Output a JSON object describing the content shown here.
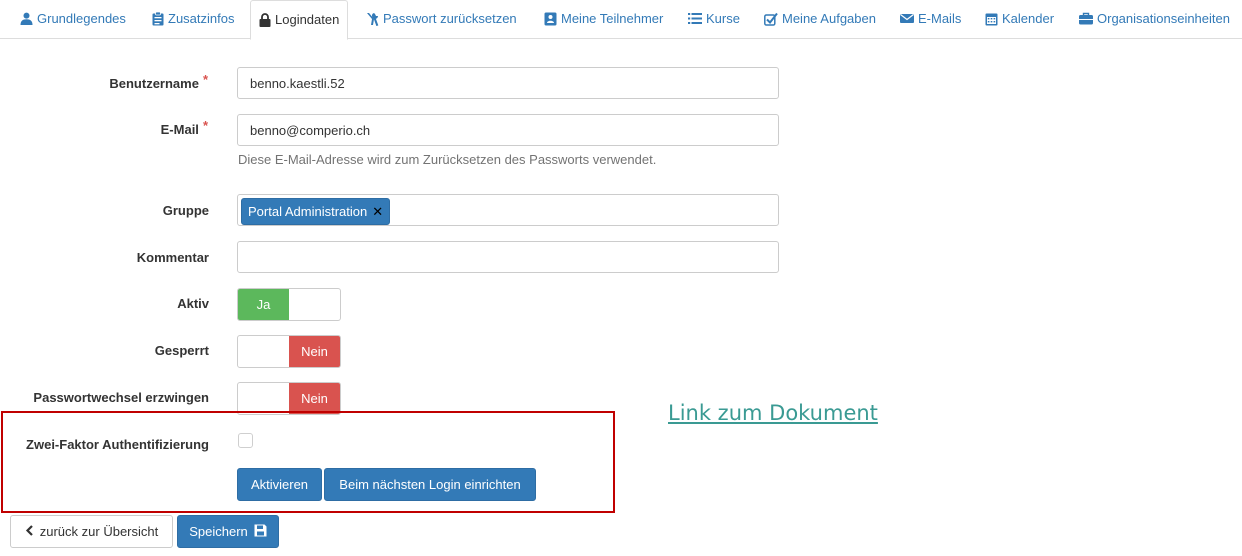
{
  "tabs": [
    {
      "label": "Grundlegendes",
      "icon": "user-icon"
    },
    {
      "label": "Zusatzinfos",
      "icon": "clipboard-icon"
    },
    {
      "label": "Logindaten",
      "icon": "lock-icon",
      "active": true
    },
    {
      "label": "Passwort zurücksetzen",
      "icon": "tools-icon"
    },
    {
      "label": "Meine Teilnehmer",
      "icon": "contact-card-icon"
    },
    {
      "label": "Kurse",
      "icon": "list-icon"
    },
    {
      "label": "Meine Aufgaben",
      "icon": "check-square-icon"
    },
    {
      "label": "E-Mails",
      "icon": "envelope-icon"
    },
    {
      "label": "Kalender",
      "icon": "calendar-icon"
    },
    {
      "label": "Organisationseinheiten",
      "icon": "briefcase-icon"
    }
  ],
  "form": {
    "username": {
      "label": "Benutzername",
      "required": "*",
      "value": "benno.kaestli.52"
    },
    "email": {
      "label": "E-Mail",
      "required": "*",
      "value": "benno@comperio.ch",
      "help": "Diese E-Mail-Adresse wird zum Zurücksetzen des Passworts verwendet."
    },
    "group": {
      "label": "Gruppe",
      "tag": "Portal Administration",
      "remove": "✕"
    },
    "comment": {
      "label": "Kommentar",
      "value": ""
    },
    "active": {
      "label": "Aktiv",
      "value": "Ja"
    },
    "locked": {
      "label": "Gesperrt",
      "value": "Nein"
    },
    "force_pw_change": {
      "label": "Passwortwechsel erzwingen",
      "value": "Nein"
    },
    "two_factor": {
      "label": "Zwei-Faktor Authentifizierung",
      "checked": false,
      "activate_label": "Aktivieren",
      "next_login_label": "Beim nächsten Login einrichten"
    }
  },
  "footer": {
    "back_label": "zurück zur Übersicht",
    "save_label": "Speichern"
  },
  "doc_link": "Link zum Dokument",
  "colors": {
    "primary": "#337ab7",
    "success": "#5cb85c",
    "danger": "#d9534f",
    "highlight_border": "#c00000",
    "link": "#3a9a93"
  }
}
